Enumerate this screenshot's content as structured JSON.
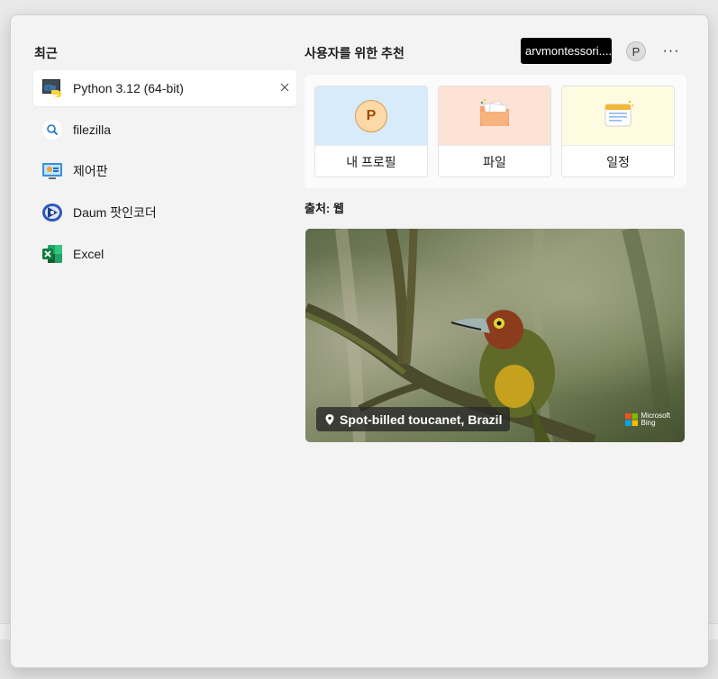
{
  "recent": {
    "title": "최근",
    "items": [
      {
        "label": "Python 3.12 (64-bit)",
        "icon": "python-icon",
        "active": true
      },
      {
        "label": "filezilla",
        "icon": "search-icon"
      },
      {
        "label": "제어판",
        "icon": "control-panel-icon"
      },
      {
        "label": "Daum 팟인코더",
        "icon": "daum-potencoder-icon"
      },
      {
        "label": "Excel",
        "icon": "excel-icon"
      }
    ]
  },
  "recommended": {
    "title": "사용자를 위한 추천",
    "account": "arvmontessori....",
    "avatar_letter": "P",
    "more": "···",
    "cards": [
      {
        "label": "내 프로필",
        "icon": "profile-icon",
        "letter": "P"
      },
      {
        "label": "파일",
        "icon": "folder-icon"
      },
      {
        "label": "일정",
        "icon": "calendar-icon"
      }
    ],
    "source": "출처: 웹",
    "image_caption": "Spot-billed toucanet, Brazil",
    "bing_line1": "Microsoft",
    "bing_line2": "Bing"
  },
  "colors": {
    "profile_bg": "#d8ebfb",
    "files_bg": "#fde2d6",
    "calendar_bg": "#fefbe0",
    "account_chip": "#000000"
  }
}
